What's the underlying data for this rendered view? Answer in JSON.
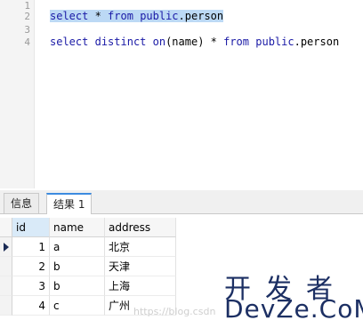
{
  "editor": {
    "line_numbers": [
      "1",
      "2",
      "3",
      "4"
    ],
    "line2": {
      "kw1": "select",
      "sym": " * ",
      "kw2": "from",
      "sp": " ",
      "kw3": "public",
      "rest": ".person"
    },
    "line4": {
      "kw1": "select",
      "sp1": " ",
      "kw2": "distinct",
      "sp2": " ",
      "kw3": "on",
      "mid": "(name) * ",
      "kw4": "from",
      "sp3": " ",
      "kw5": "public",
      "rest": ".person"
    }
  },
  "tabs": [
    {
      "label": "信息"
    },
    {
      "label": "结果 1"
    }
  ],
  "results": {
    "columns": [
      "id",
      "name",
      "address"
    ],
    "rows": [
      {
        "id": "1",
        "name": "a",
        "address": "北京"
      },
      {
        "id": "2",
        "name": "b",
        "address": "天津"
      },
      {
        "id": "3",
        "name": "b",
        "address": "上海"
      },
      {
        "id": "4",
        "name": "c",
        "address": "广州"
      }
    ],
    "current_row": 1
  },
  "watermarks": {
    "blog": "https://blog.csdn",
    "brand_top": "开发者",
    "brand_bottom": "DevZe.CoM"
  }
}
